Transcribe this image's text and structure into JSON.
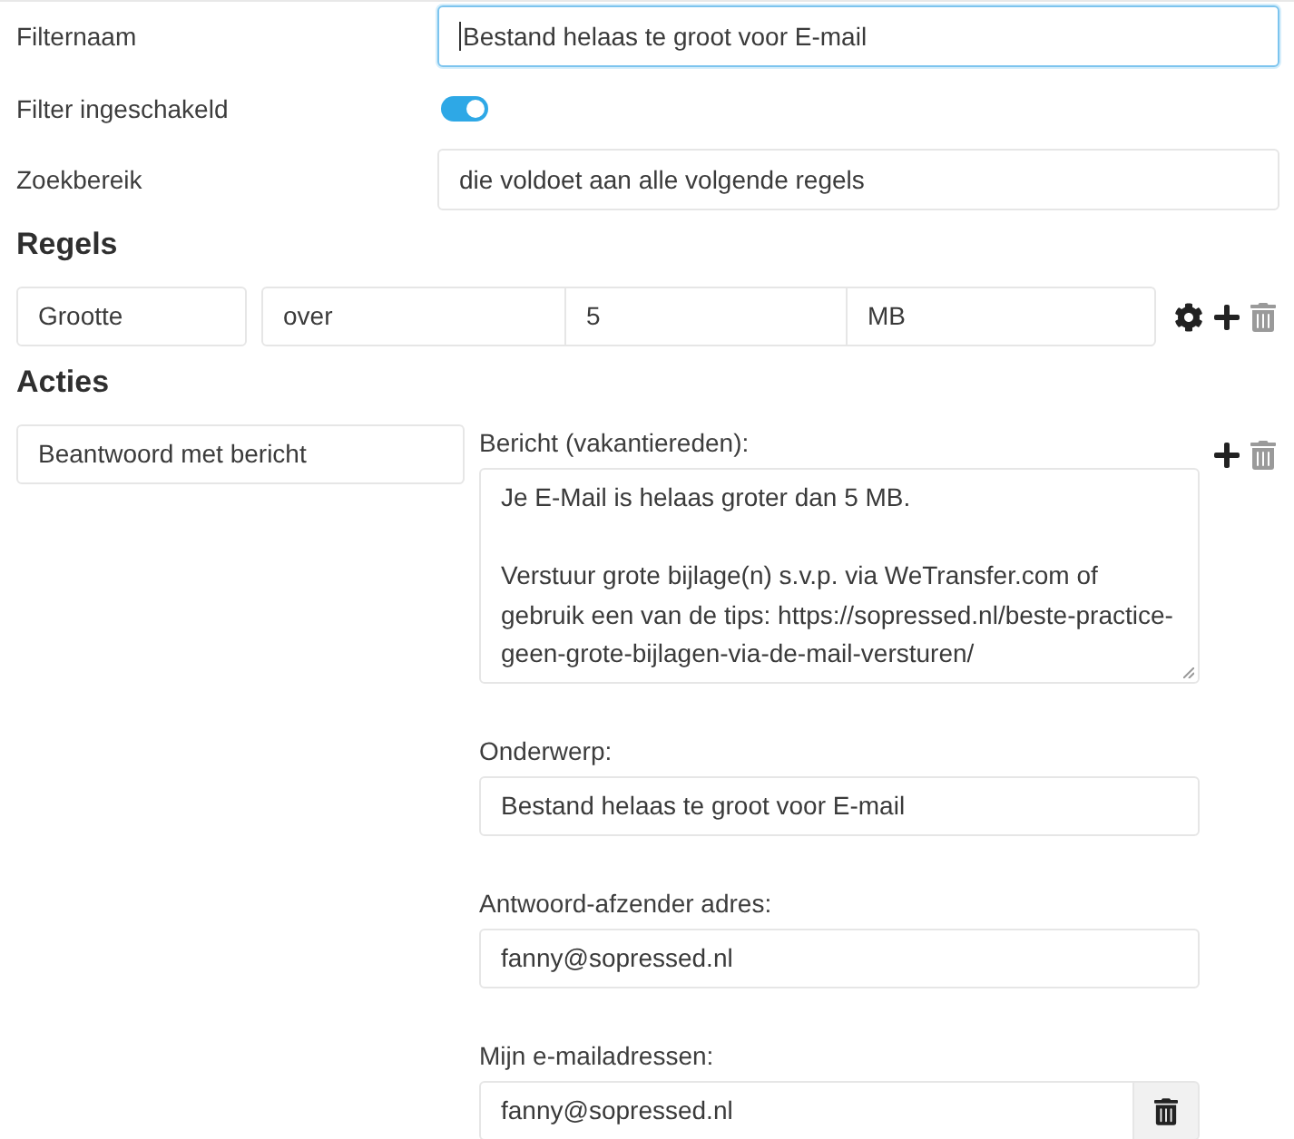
{
  "fields": [
    {
      "kind": "input",
      "label": "Filternaam",
      "value": "Bestand helaas te groot voor E-mail",
      "focused": true
    },
    {
      "kind": "toggle",
      "label": "Filter ingeschakeld",
      "on": true
    },
    {
      "kind": "input",
      "label": "Zoekbereik",
      "value": "die voldoet aan alle volgende regels",
      "focused": false
    }
  ],
  "rules": {
    "heading": "Regels",
    "items": [
      {
        "field": "Grootte",
        "operator": "over",
        "value": "5",
        "unit": "MB"
      }
    ]
  },
  "actions": {
    "heading": "Acties",
    "items": [
      {
        "type": "Beantwoord met bericht",
        "fields": [
          {
            "kind": "textarea",
            "label": "Bericht (vakantiereden):",
            "value": "Je E-Mail is helaas groter dan 5 MB.\n\nVerstuur grote bijlage(n) s.v.p. via WeTransfer.com of gebruik een van de tips: https://sopressed.nl/beste-practice-geen-grote-bijlagen-via-de-mail-versturen/"
          },
          {
            "kind": "input",
            "label": "Onderwerp:",
            "value": "Bestand helaas te groot voor E-mail",
            "removable": false
          },
          {
            "kind": "input",
            "label": "Antwoord-afzender adres:",
            "value": "fanny@sopressed.nl",
            "removable": false
          },
          {
            "kind": "input",
            "label": "Mijn e-mailadressen:",
            "value": "fanny@sopressed.nl",
            "removable": true
          }
        ]
      }
    ]
  }
}
